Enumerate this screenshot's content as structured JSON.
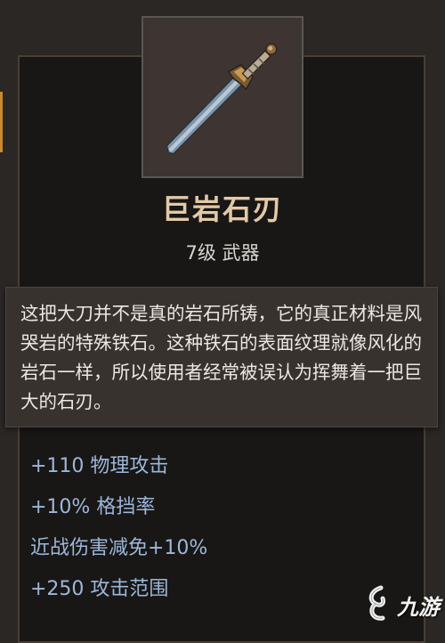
{
  "item": {
    "name": "巨岩石刃",
    "subtitle": "7级 武器",
    "icon": "greatsword-icon",
    "description": "这把大刀并不是真的岩石所铸，它的真正材料是风哭岩的特殊铁石。这种铁石的表面纹理就像风化的岩石一样，所以使用者经常被误认为挥舞着一把巨大的石刃。"
  },
  "stats": [
    "+110 物理攻击",
    "+10% 格挡率",
    "近战伤害减免+10%",
    "+250 攻击范围"
  ],
  "watermark": {
    "logo_icon": "jiuyou-logo-icon",
    "text": "九游"
  },
  "colors": {
    "name": "#e3c9a6",
    "stat": "#9db7d9",
    "accent": "#c98a2e"
  }
}
